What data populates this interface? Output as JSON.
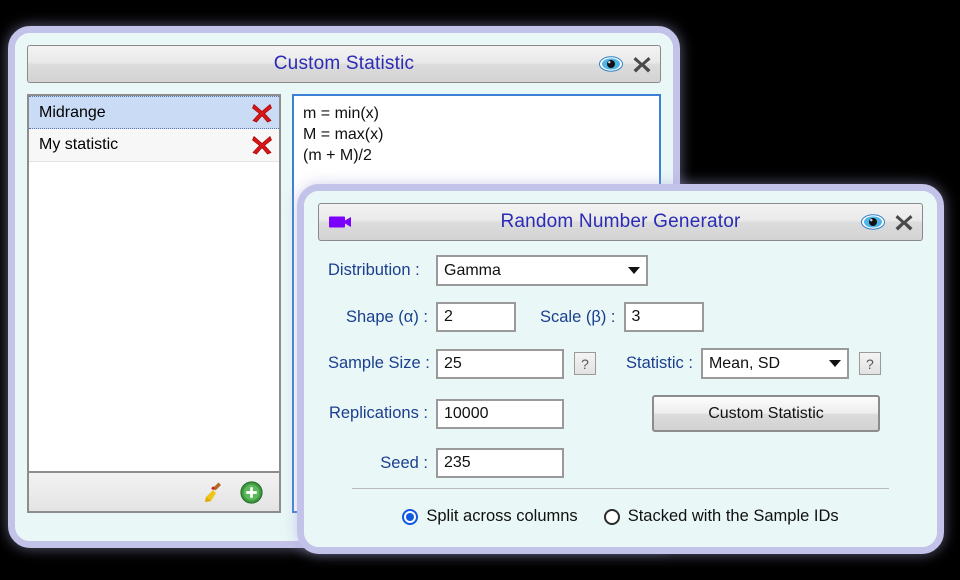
{
  "windows": {
    "custom_statistic": {
      "title": "Custom Statistic",
      "eye_icon": "eye-icon",
      "close_icon": "close-x-icon",
      "list": [
        {
          "label": "Midrange",
          "selected": true,
          "delete_icon": "red-x-delete-icon"
        },
        {
          "label": "My statistic",
          "selected": false,
          "delete_icon": "red-x-delete-icon"
        }
      ],
      "code": "m = min(x)\nM = max(x)\n(m + M)/2",
      "toolbar": {
        "clear_icon": "broom-icon",
        "add_icon": "green-plus-icon"
      }
    },
    "random_number_generator": {
      "title": "Random Number Generator",
      "camera_icon": "video-camera-icon",
      "eye_icon": "eye-icon",
      "close_icon": "close-x-icon",
      "fields": {
        "distribution_label": "Distribution :",
        "distribution_value": "Gamma",
        "shape_label": "Shape (α) :",
        "shape_value": "2",
        "scale_label": "Scale (β) :",
        "scale_value": "3",
        "sample_size_label": "Sample Size :",
        "sample_size_value": "25",
        "sample_size_help": "?",
        "statistic_label": "Statistic :",
        "statistic_value": "Mean, SD",
        "statistic_help": "?",
        "replications_label": "Replications :",
        "replications_value": "10000",
        "seed_label": "Seed :",
        "seed_value": "235"
      },
      "custom_statistic_button": "Custom Statistic",
      "output_options": [
        {
          "label": "Split across columns",
          "selected": true
        },
        {
          "label": "Stacked with the Sample IDs",
          "selected": false
        }
      ]
    }
  },
  "colors": {
    "window_border": "#c3c2e8",
    "panel_background": "#e9f7f7",
    "title_text": "#2b2bb5",
    "label_text": "#1b3f8f",
    "selected_row": "#c9dbf5",
    "editor_border": "#3c7fd6",
    "radio_accent": "#1257e0",
    "delete_icon": "#d81818",
    "camera_icon": "#7a00ff"
  }
}
